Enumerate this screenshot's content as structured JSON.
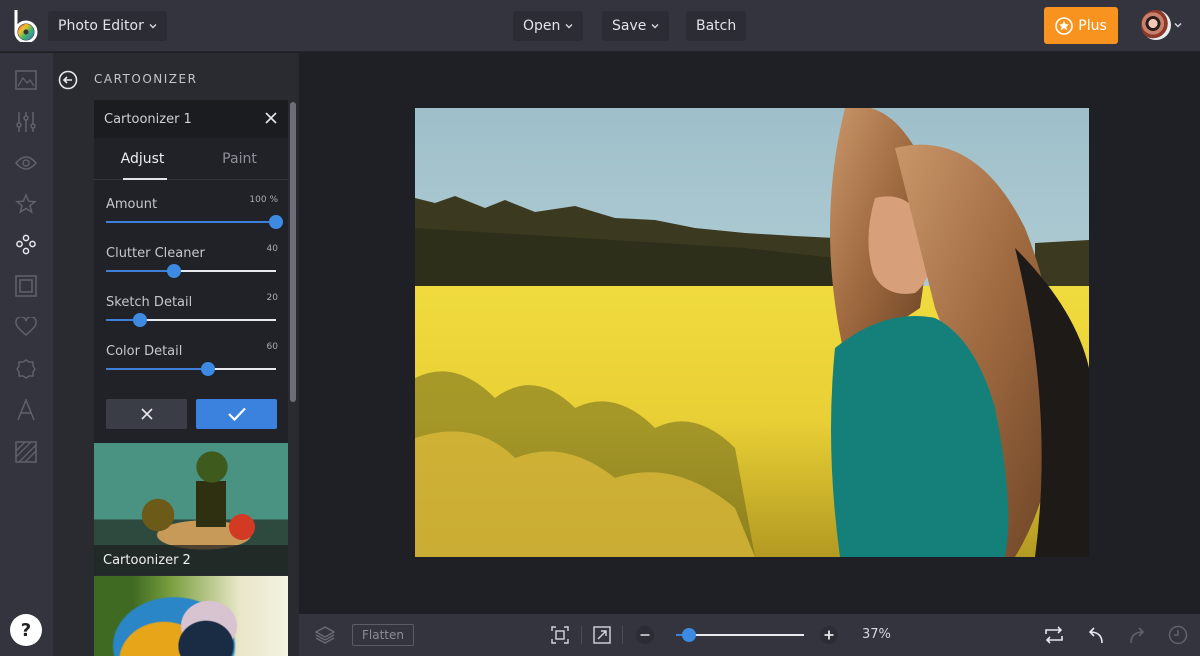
{
  "topbar": {
    "app_menu_label": "Photo Editor",
    "open_label": "Open",
    "save_label": "Save",
    "batch_label": "Batch",
    "plus_label": "Plus",
    "brand_accent": "#f7931e"
  },
  "rail": {
    "items": [
      {
        "icon": "image-icon",
        "name": "edit"
      },
      {
        "icon": "sliders-icon",
        "name": "adjust"
      },
      {
        "icon": "eye-icon",
        "name": "preview"
      },
      {
        "icon": "star-icon",
        "name": "effects"
      },
      {
        "icon": "artsy-icon",
        "name": "artsy",
        "active": true
      },
      {
        "icon": "frame-icon",
        "name": "frames"
      },
      {
        "icon": "heart-icon",
        "name": "touch-up"
      },
      {
        "icon": "badge-icon",
        "name": "graphics"
      },
      {
        "icon": "text-icon",
        "name": "text"
      },
      {
        "icon": "texture-icon",
        "name": "textures"
      }
    ],
    "help_label": "?"
  },
  "panel": {
    "title": "CARTOONIZER",
    "card_title": "Cartoonizer 1",
    "tabs": [
      {
        "label": "Adjust",
        "active": true
      },
      {
        "label": "Paint",
        "active": false
      }
    ],
    "sliders": [
      {
        "label": "Amount",
        "value_text": "100 %",
        "value": 100,
        "max": 100
      },
      {
        "label": "Clutter Cleaner",
        "value_text": "40",
        "value": 40,
        "max": 100
      },
      {
        "label": "Sketch Detail",
        "value_text": "20",
        "value": 20,
        "max": 100
      },
      {
        "label": "Color Detail",
        "value_text": "60",
        "value": 60,
        "max": 100
      }
    ],
    "presets": [
      {
        "label": "Cartoonizer 2"
      },
      {
        "label": ""
      }
    ]
  },
  "bottombar": {
    "flatten_label": "Flatten",
    "zoom_text": "37%",
    "zoom_fraction": 0.1
  }
}
